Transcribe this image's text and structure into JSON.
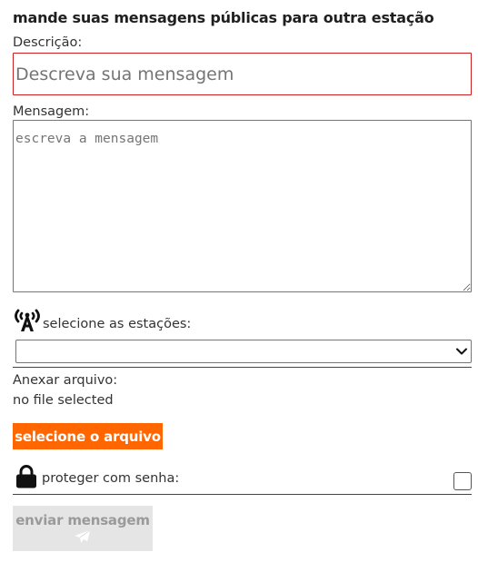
{
  "title": "mande suas mensagens públicas para outra estação",
  "description": {
    "label": "Descrição:",
    "placeholder": "Descreva sua mensagem",
    "value": ""
  },
  "message": {
    "label": "Mensagem:",
    "placeholder": "escreva a mensagem",
    "value": ""
  },
  "stations": {
    "icon": "antenna-broadcast-icon",
    "label": "selecione as estações:",
    "selected": ""
  },
  "attachment": {
    "label": "Anexar arquivo:",
    "status": "no file selected",
    "button_label": "selecione o arquivo"
  },
  "password": {
    "icon": "lock-icon",
    "label": "proteger com senha:",
    "checked": false
  },
  "send": {
    "label": "enviar mensagem",
    "icon": "send-icon",
    "disabled": true
  },
  "colors": {
    "accent": "#ff6600",
    "error_border": "#cc1f1f",
    "disabled_bg": "#e5e5e5",
    "disabled_text": "#9a9a9a"
  }
}
